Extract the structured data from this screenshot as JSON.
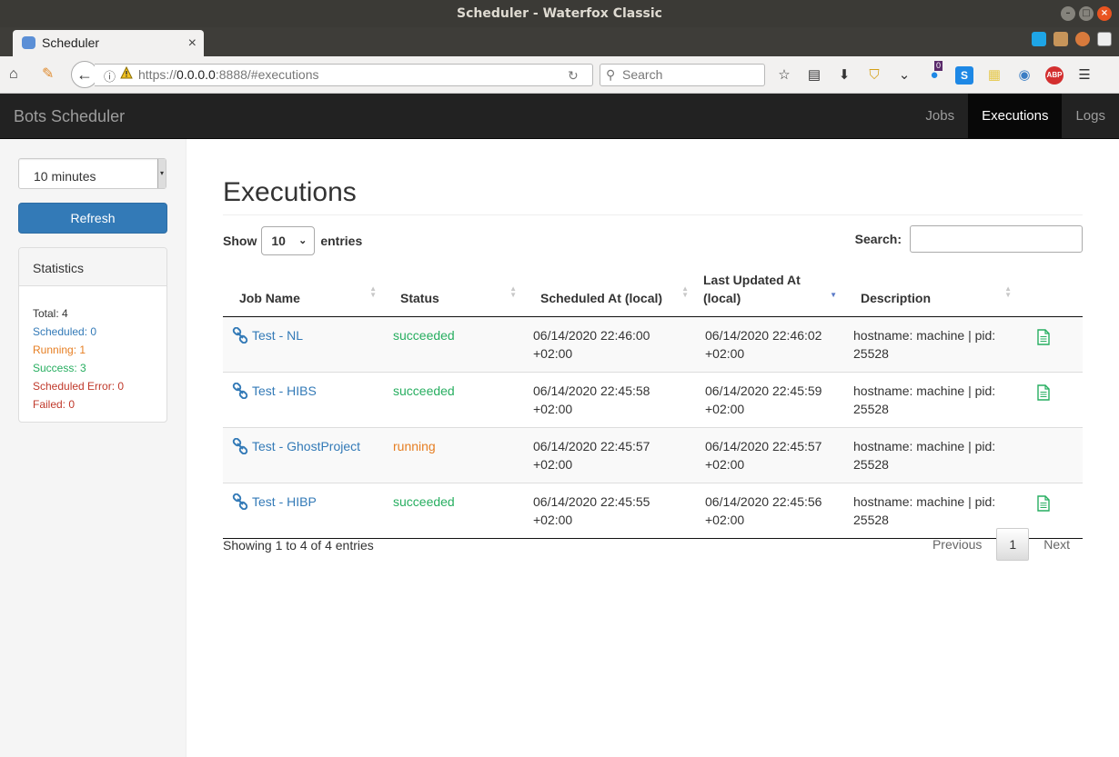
{
  "browser": {
    "window_title": "Scheduler - Waterfox Classic",
    "tab_title": "Scheduler",
    "url_scheme": "https://",
    "url_host": "0.0.0.0",
    "url_rest": ":8888/#executions",
    "search_placeholder": "Search",
    "badge_count": "0"
  },
  "app": {
    "brand": "Bots Scheduler",
    "nav": [
      {
        "label": "Jobs",
        "active": false
      },
      {
        "label": "Executions",
        "active": true
      },
      {
        "label": "Logs",
        "active": false
      }
    ]
  },
  "sidebar": {
    "interval": "10 minutes",
    "refresh_label": "Refresh",
    "stats_title": "Statistics",
    "stats": {
      "total": "Total: 4",
      "scheduled": "Scheduled: 0",
      "running": "Running: 1",
      "success": "Success: 3",
      "scheduled_error": "Scheduled Error: 0",
      "failed": "Failed: 0"
    }
  },
  "main": {
    "title": "Executions",
    "show_label": "Show",
    "page_length": "10",
    "entries_label": "entries",
    "search_label": "Search:",
    "columns": [
      "Job Name",
      "Status",
      "Scheduled At (local)",
      "Last Updated At (local)",
      "Description"
    ],
    "rows": [
      {
        "job": "Test - NL",
        "status": "succeeded",
        "scheduled": "06/14/2020 22:46:00 +02:00",
        "updated": "06/14/2020 22:46:02 +02:00",
        "description": "hostname: machine | pid: 25528",
        "has_log": true
      },
      {
        "job": "Test - HIBS",
        "status": "succeeded",
        "scheduled": "06/14/2020 22:45:58 +02:00",
        "updated": "06/14/2020 22:45:59 +02:00",
        "description": "hostname: machine | pid: 25528",
        "has_log": true
      },
      {
        "job": "Test - GhostProject",
        "status": "running",
        "scheduled": "06/14/2020 22:45:57 +02:00",
        "updated": "06/14/2020 22:45:57 +02:00",
        "description": "hostname: machine | pid: 25528",
        "has_log": false
      },
      {
        "job": "Test - HIBP",
        "status": "succeeded",
        "scheduled": "06/14/2020 22:45:55 +02:00",
        "updated": "06/14/2020 22:45:56 +02:00",
        "description": "hostname: machine | pid: 25528",
        "has_log": true
      }
    ],
    "info": "Showing 1 to 4 of 4 entries",
    "pagination": {
      "previous": "Previous",
      "current": "1",
      "next": "Next"
    }
  },
  "colors": {
    "primary": "#337ab7",
    "success": "#27ae60",
    "warning": "#e67e22",
    "danger": "#c0392b",
    "navbar": "#222222"
  }
}
